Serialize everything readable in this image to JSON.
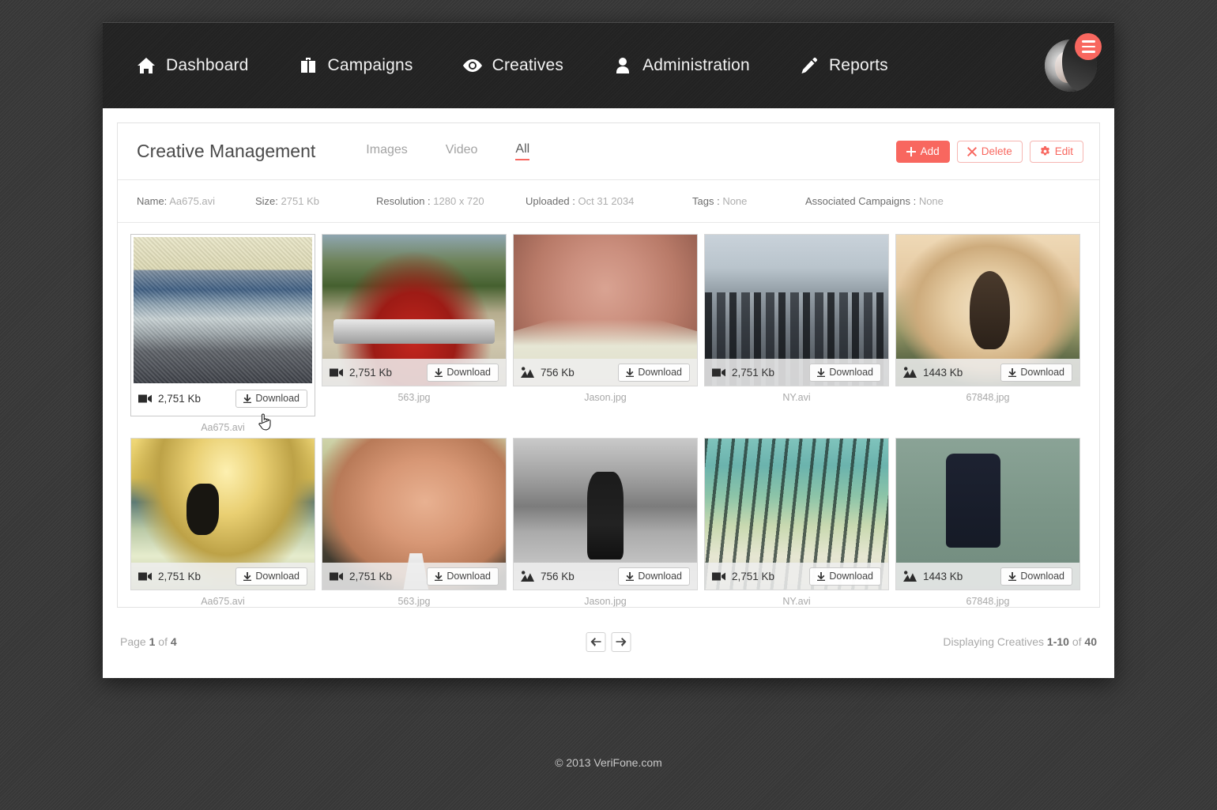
{
  "nav": {
    "items": [
      {
        "label": "Dashboard",
        "icon": "home-icon"
      },
      {
        "label": "Campaigns",
        "icon": "briefcase-icon"
      },
      {
        "label": "Creatives",
        "icon": "eye-icon"
      },
      {
        "label": "Administration",
        "icon": "user-icon"
      },
      {
        "label": "Reports",
        "icon": "pencil-icon"
      }
    ],
    "avatar_alt": "user-avatar",
    "menu_badge": "hamburger-icon"
  },
  "panel": {
    "title": "Creative Management",
    "tabs": [
      {
        "label": "Images",
        "active": false
      },
      {
        "label": "Video",
        "active": false
      },
      {
        "label": "All",
        "active": true
      }
    ],
    "actions": {
      "add": "Add",
      "delete": "Delete",
      "edit": "Edit"
    }
  },
  "meta": [
    {
      "label": "Name:",
      "value": "Aa675.avi"
    },
    {
      "label": "Size:",
      "value": "2751 Kb"
    },
    {
      "label": "Resolution :",
      "value": "1280 x 720"
    },
    {
      "label": "Uploaded :",
      "value": "Oct 31 2034"
    },
    {
      "label": "Tags :",
      "value": "None"
    },
    {
      "label": "Associated Campaigns :",
      "value": "None"
    }
  ],
  "download_label": "Download",
  "creatives": [
    {
      "name": "Aa675.avi",
      "size": "2,751 Kb",
      "type": "video",
      "art": "tx-wave",
      "selected": true
    },
    {
      "name": "563.jpg",
      "size": "2,751 Kb",
      "type": "video",
      "art": "tx-cars",
      "selected": false
    },
    {
      "name": "Jason.jpg",
      "size": "756 Kb",
      "type": "image",
      "art": "tx-skin",
      "selected": false
    },
    {
      "name": "NY.avi",
      "size": "2,751 Kb",
      "type": "video",
      "art": "tx-city",
      "selected": false
    },
    {
      "name": "67848.jpg",
      "size": "1443 Kb",
      "type": "image",
      "art": "tx-splash",
      "selected": false
    },
    {
      "name": "Aa675.avi",
      "size": "2,751 Kb",
      "type": "video",
      "art": "tx-surf",
      "selected": false
    },
    {
      "name": "563.jpg",
      "size": "2,751 Kb",
      "type": "video",
      "art": "tx-face",
      "selected": false
    },
    {
      "name": "Jason.jpg",
      "size": "756 Kb",
      "type": "image",
      "art": "tx-bw",
      "selected": false
    },
    {
      "name": "NY.avi",
      "size": "2,751 Kb",
      "type": "video",
      "art": "tx-forest",
      "selected": false
    },
    {
      "name": "67848.jpg",
      "size": "1443 Kb",
      "type": "image",
      "art": "tx-coat",
      "selected": false
    }
  ],
  "footer": {
    "page_prefix": "Page",
    "page_current": "1",
    "page_mid": "of",
    "page_total": "4",
    "prev": "arrow-left-icon",
    "next": "arrow-right-icon",
    "displaying_prefix": "Displaying Creatives",
    "displaying_range": "1-10",
    "displaying_mid": "of",
    "displaying_total": "40"
  },
  "copyright": "© 2013  VeriFone.com",
  "colors": {
    "accent": "#f8675f",
    "nav_bg": "#242424",
    "page_bg": "#3a3a3a",
    "panel_bg": "#ffffff"
  }
}
